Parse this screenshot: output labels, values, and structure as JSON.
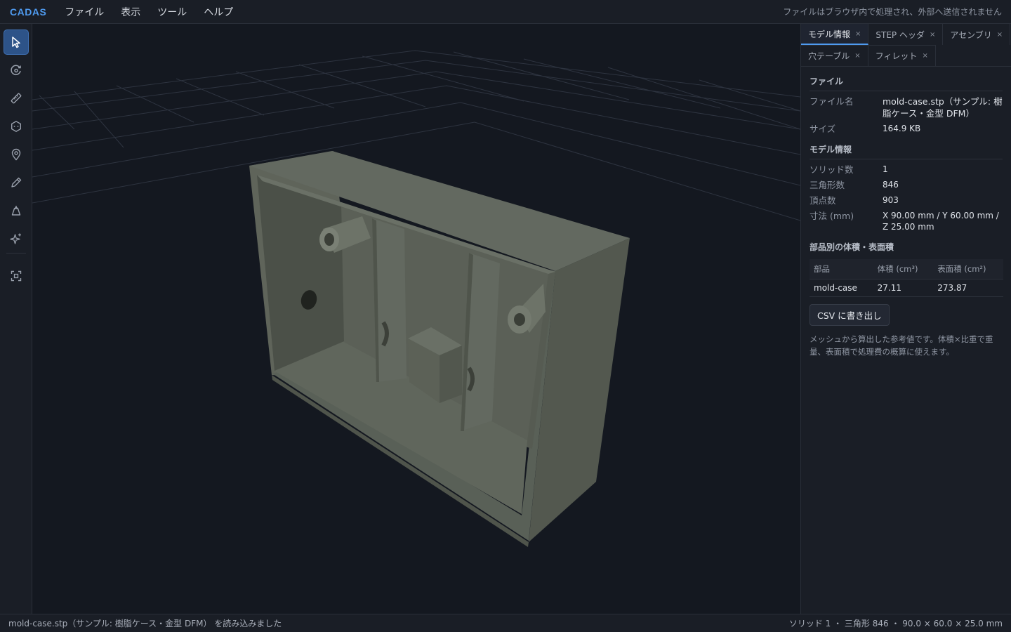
{
  "app": {
    "brand": "CADAS",
    "privacy_note": "ファイルはブラウザ内で処理され、外部へ送信されません"
  },
  "menu": [
    "ファイル",
    "表示",
    "ツール",
    "ヘルプ"
  ],
  "toolbar": {
    "tools": [
      {
        "name": "select-tool",
        "icon": "cursor-icon",
        "active": true
      },
      {
        "name": "orbit-tool",
        "icon": "orbit-icon",
        "active": false
      },
      {
        "name": "measure-tool",
        "icon": "ruler-icon",
        "active": false
      },
      {
        "name": "feature-tool",
        "icon": "hexagon-icon",
        "active": false
      },
      {
        "name": "marker-tool",
        "icon": "pin-icon",
        "active": false
      },
      {
        "name": "annotate-tool",
        "icon": "pencil-icon",
        "active": false
      },
      {
        "name": "draft-analysis-tool",
        "icon": "draft-icon",
        "active": false
      },
      {
        "name": "ai-tool",
        "icon": "sparkle-icon",
        "active": false
      },
      {
        "name": "fit-view-tool",
        "icon": "fit-view-icon",
        "active": false
      }
    ]
  },
  "panel": {
    "tabs": [
      {
        "label": "モデル情報",
        "active": true
      },
      {
        "label": "STEP ヘッダ",
        "active": false
      },
      {
        "label": "アセンブリ",
        "active": false
      },
      {
        "label": "穴テーブル",
        "active": false
      },
      {
        "label": "フィレット",
        "active": false
      }
    ],
    "close_glyph": "×",
    "file_section": {
      "title": "ファイル",
      "filename_label": "ファイル名",
      "filename_value": "mold-case.stp（サンプル: 樹脂ケース・金型 DFM）",
      "size_label": "サイズ",
      "size_value": "164.9 KB"
    },
    "model_section": {
      "title": "モデル情報",
      "solids_label": "ソリッド数",
      "solids_value": "1",
      "triangles_label": "三角形数",
      "triangles_value": "846",
      "vertices_label": "頂点数",
      "vertices_value": "903",
      "dims_label": "寸法 (mm)",
      "dims_value": "X 90.00 mm / Y 60.00 mm / Z 25.00 mm"
    },
    "parts_section": {
      "title": "部品別の体積・表面積",
      "headers": [
        "部品",
        "体積 (cm³)",
        "表面積 (cm²)"
      ],
      "rows": [
        {
          "part": "mold-case",
          "volume": "27.11",
          "area": "273.87"
        }
      ],
      "csv_button": "CSV に書き出し",
      "note": "メッシュから算出した参考値です。体積×比重で重量、表面積で処理費の概算に使えます。"
    }
  },
  "status": {
    "left": "mold-case.stp（サンプル: 樹脂ケース・金型 DFM） を読み込みました",
    "right": "ソリッド 1 ・ 三角形 846 ・ 90.0 × 60.0 × 25.0 mm"
  },
  "colors": {
    "accent": "#4f9bf0",
    "model_face": "#5d6258",
    "background": "#141820"
  }
}
